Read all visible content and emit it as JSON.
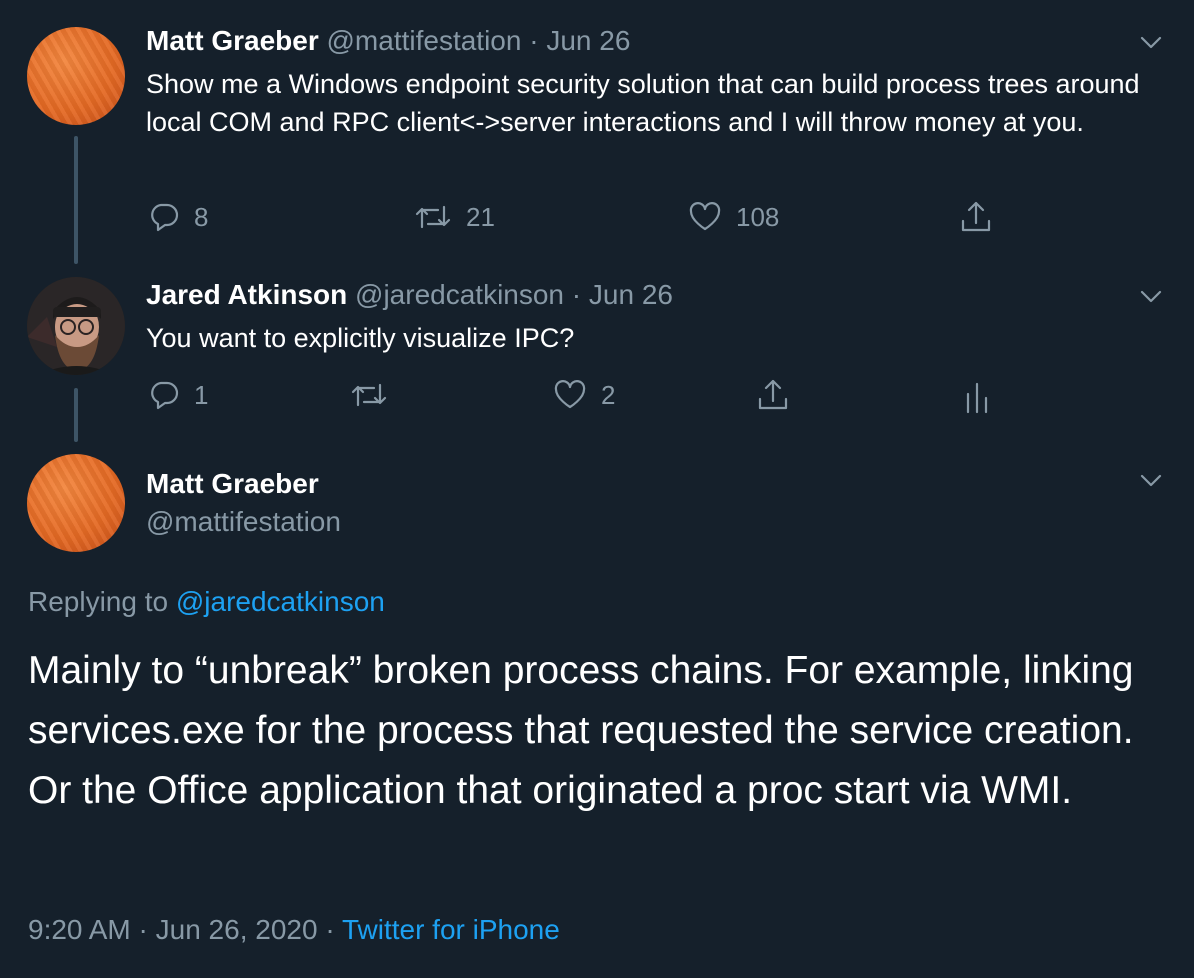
{
  "colors": {
    "background": "#15202b",
    "secondary_text": "#8899a6",
    "link": "#1da1f2",
    "thread_line": "#3d5466",
    "avatar_orange": "#e56a24"
  },
  "tweet1": {
    "name": "Matt Graeber",
    "handle": "@mattifestation",
    "separator": "·",
    "date": "Jun 26",
    "text": "Show me a Windows endpoint security solution that can build process trees around local COM and RPC client<->server interactions and I will throw money at you.",
    "actions": {
      "reply_count": "8",
      "retweet_count": "21",
      "like_count": "108"
    },
    "icons": [
      "reply-icon",
      "retweet-icon",
      "like-icon",
      "share-icon",
      "chevron-down-icon"
    ]
  },
  "tweet2": {
    "name": "Jared Atkinson",
    "handle": "@jaredcatkinson",
    "separator": "·",
    "date": "Jun 26",
    "text": "You want to explicitly visualize IPC?",
    "actions": {
      "reply_count": "1",
      "retweet_count": "",
      "like_count": "2"
    },
    "icons": [
      "reply-icon",
      "retweet-icon",
      "like-icon",
      "share-icon",
      "analytics-icon",
      "chevron-down-icon"
    ]
  },
  "main_tweet": {
    "name": "Matt Graeber",
    "handle": "@mattifestation",
    "replying_prefix": "Replying to",
    "replying_to": "@jaredcatkinson",
    "text": "Mainly to “unbreak” broken process chains. For example, linking services.exe for the process that requested the service creation. Or the Office application that originated a proc start via WMI.",
    "time": "9:20 AM",
    "separator": "·",
    "date": "Jun 26, 2020",
    "source": "Twitter for iPhone"
  }
}
